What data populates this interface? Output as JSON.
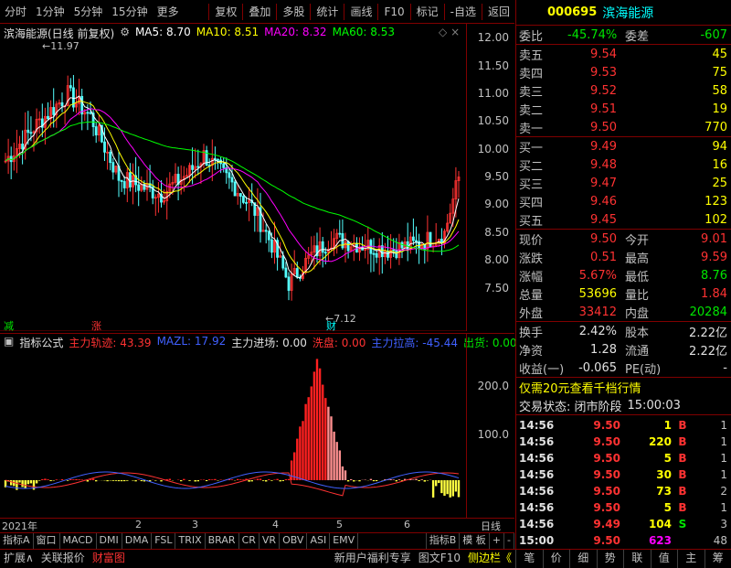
{
  "toolbar": {
    "left": [
      "分时",
      "1分钟",
      "5分钟",
      "15分钟",
      "更多"
    ],
    "right": [
      "复权",
      "叠加",
      "多股",
      "统计",
      "画线",
      "F10",
      "标记",
      "-自选",
      "返回"
    ]
  },
  "stock": {
    "code": "000695",
    "name": "滨海能源",
    "chart_title": "滨海能源(日线 前复权)"
  },
  "ma_legend": [
    {
      "label": "MA5: 8.70",
      "color": "#ffffff"
    },
    {
      "label": "MA10: 8.51",
      "color": "#ffff00"
    },
    {
      "label": "MA20: 8.32",
      "color": "#ff00ff"
    },
    {
      "label": "MA60: 8.53",
      "color": "#00ff00"
    }
  ],
  "price_axis": [
    "12.00",
    "11.50",
    "11.00",
    "10.50",
    "10.00",
    "9.50",
    "9.00",
    "8.50",
    "8.00",
    "7.50"
  ],
  "annotations": {
    "high": "11.97",
    "low": "7.12",
    "label_jian": "减",
    "label_zhang": "涨",
    "label_cai": "财"
  },
  "indicator": {
    "name": "指标公式",
    "items": [
      {
        "label": "主力轨迹: 43.39",
        "color": "#ff3232"
      },
      {
        "label": "MAZL: 17.92",
        "color": "#4060ff"
      },
      {
        "label": "主力进场: 0.00",
        "color": "#e0e0e0"
      },
      {
        "label": "洗盘: 0.00",
        "color": "#ff3232"
      },
      {
        "label": "主力拉高: -45.44",
        "color": "#4060ff"
      },
      {
        "label": "出货: 0.00",
        "color": "#00e600"
      }
    ],
    "axis": [
      "200.0",
      "100.0"
    ]
  },
  "dates": {
    "year": "2021年",
    "months": [
      "2",
      "3",
      "4",
      "5",
      "6"
    ],
    "period": "日线"
  },
  "tabs": [
    "指标A",
    "窗口",
    "MACD",
    "DMI",
    "DMA",
    "FSL",
    "TRIX",
    "BRAR",
    "CR",
    "VR",
    "OBV",
    "ASI",
    "EMV",
    "",
    "指标B",
    "模 板",
    "+",
    "-"
  ],
  "status_bar": {
    "left": [
      "扩展∧",
      "关联报价",
      "财富图"
    ],
    "right": [
      "新用户福利专享",
      "图文F10",
      "侧边栏《"
    ]
  },
  "quote": {
    "weibi_label": "委比",
    "weibi": "-45.74%",
    "weicha_label": "委差",
    "weicha": "-607",
    "sell": [
      {
        "label": "卖五",
        "price": "9.54",
        "vol": "45"
      },
      {
        "label": "卖四",
        "price": "9.53",
        "vol": "75"
      },
      {
        "label": "卖三",
        "price": "9.52",
        "vol": "58"
      },
      {
        "label": "卖二",
        "price": "9.51",
        "vol": "19"
      },
      {
        "label": "卖一",
        "price": "9.50",
        "vol": "770"
      }
    ],
    "buy": [
      {
        "label": "买一",
        "price": "9.49",
        "vol": "94"
      },
      {
        "label": "买二",
        "price": "9.48",
        "vol": "16"
      },
      {
        "label": "买三",
        "price": "9.47",
        "vol": "25"
      },
      {
        "label": "买四",
        "price": "9.46",
        "vol": "123"
      },
      {
        "label": "买五",
        "price": "9.45",
        "vol": "102"
      }
    ],
    "stats": [
      {
        "l1": "现价",
        "v1": "9.50",
        "c1": "red",
        "l2": "今开",
        "v2": "9.01",
        "c2": "red"
      },
      {
        "l1": "涨跌",
        "v1": "0.51",
        "c1": "red",
        "l2": "最高",
        "v2": "9.59",
        "c2": "red"
      },
      {
        "l1": "涨幅",
        "v1": "5.67%",
        "c1": "red",
        "l2": "最低",
        "v2": "8.76",
        "c2": "green"
      },
      {
        "l1": "总量",
        "v1": "53696",
        "c1": "yellow",
        "l2": "量比",
        "v2": "1.84",
        "c2": "red"
      },
      {
        "l1": "外盘",
        "v1": "33412",
        "c1": "red",
        "l2": "内盘",
        "v2": "20284",
        "c2": "green"
      }
    ],
    "stats2": [
      {
        "l1": "换手",
        "v1": "2.42%",
        "l2": "股本",
        "v2": "2.22亿"
      },
      {
        "l1": "净资",
        "v1": "1.28",
        "l2": "流通",
        "v2": "2.22亿"
      },
      {
        "l1": "收益(一)",
        "v1": "-0.065",
        "l2": "PE(动)",
        "v2": "-"
      }
    ],
    "promo": "仅需20元查看千档行情",
    "trade_state_label": "交易状态: 闭市阶段",
    "trade_state_time": "15:00:03"
  },
  "trades": [
    {
      "time": "14:56",
      "price": "9.50",
      "vol": "1",
      "bs": "B",
      "n": "1",
      "pc": "red",
      "vc": "yellow",
      "bc": "red"
    },
    {
      "time": "14:56",
      "price": "9.50",
      "vol": "220",
      "bs": "B",
      "n": "1",
      "pc": "red",
      "vc": "yellow",
      "bc": "red"
    },
    {
      "time": "14:56",
      "price": "9.50",
      "vol": "5",
      "bs": "B",
      "n": "1",
      "pc": "red",
      "vc": "yellow",
      "bc": "red"
    },
    {
      "time": "14:56",
      "price": "9.50",
      "vol": "30",
      "bs": "B",
      "n": "1",
      "pc": "red",
      "vc": "yellow",
      "bc": "red"
    },
    {
      "time": "14:56",
      "price": "9.50",
      "vol": "73",
      "bs": "B",
      "n": "2",
      "pc": "red",
      "vc": "yellow",
      "bc": "red"
    },
    {
      "time": "14:56",
      "price": "9.50",
      "vol": "5",
      "bs": "B",
      "n": "1",
      "pc": "red",
      "vc": "yellow",
      "bc": "red"
    },
    {
      "time": "14:56",
      "price": "9.49",
      "vol": "104",
      "bs": "S",
      "n": "3",
      "pc": "red",
      "vc": "yellow",
      "bc": "green"
    },
    {
      "time": "15:00",
      "price": "9.50",
      "vol": "623",
      "bs": "",
      "n": "48",
      "pc": "red",
      "vc": "magenta",
      "bc": "red"
    }
  ],
  "right_tabs": [
    "笔",
    "价",
    "细",
    "势",
    "联",
    "值",
    "主",
    "筹"
  ]
}
